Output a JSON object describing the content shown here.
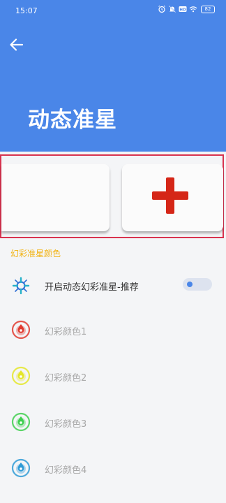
{
  "status_bar": {
    "time": "15:07",
    "battery": "82"
  },
  "header": {
    "title": "动态准星"
  },
  "section": {
    "label": "幻彩准星颜色"
  },
  "toggle_row": {
    "label": "开启动态幻彩准星-推荐",
    "enabled": false
  },
  "colors": [
    {
      "label": "幻彩颜色1",
      "color": "#e03a2f"
    },
    {
      "label": "幻彩颜色2",
      "color": "#e4e62a"
    },
    {
      "label": "幻彩颜色3",
      "color": "#3fcf4f"
    },
    {
      "label": "幻彩颜色4",
      "color": "#2f9bd6"
    }
  ],
  "theme": {
    "header_bg": "#4a86e8",
    "accent": "#f1b313",
    "plus_color": "#d52617",
    "frame": "#d8334f"
  }
}
